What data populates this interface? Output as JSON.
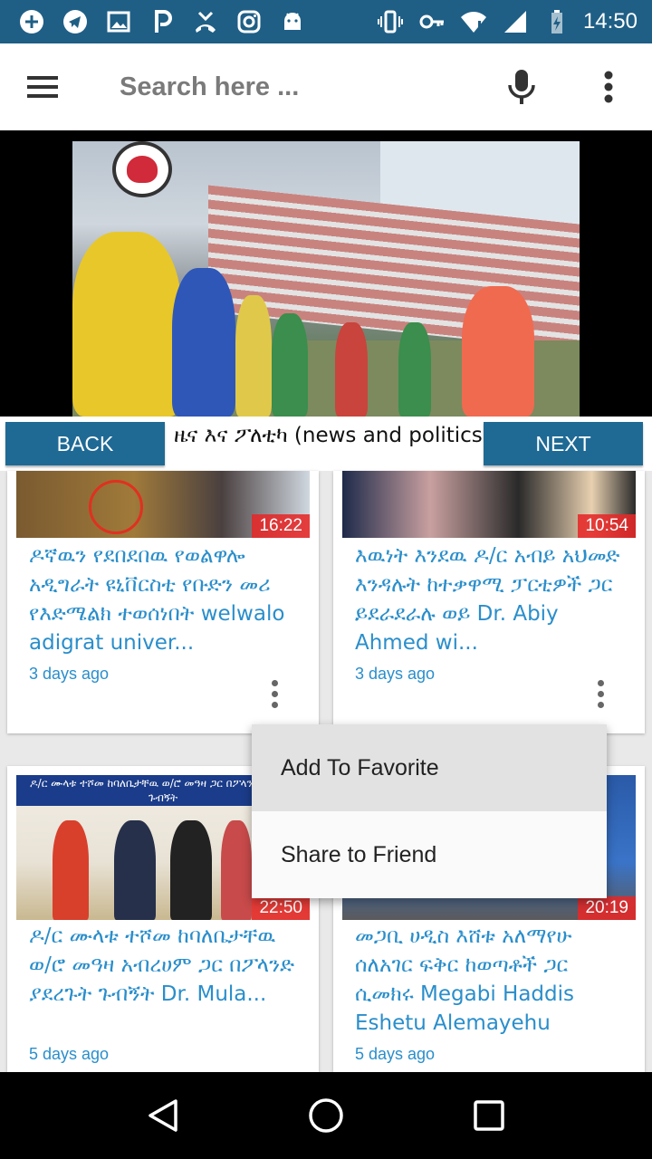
{
  "status_bar": {
    "time": "14:50",
    "left_icons": [
      "add-circle-icon",
      "telegram-icon",
      "image-icon",
      "parking-icon",
      "missed-call-icon",
      "instagram-icon",
      "android-icon"
    ],
    "right_icons": [
      "vibrate-icon",
      "key-icon",
      "wifi-icon",
      "signal-icon",
      "battery-charging-icon"
    ]
  },
  "toolbar": {
    "search_placeholder": "Search here ...",
    "menu_icon": "hamburger-menu-icon",
    "mic_icon": "microphone-icon",
    "overflow_icon": "more-vert-icon"
  },
  "navigation": {
    "back_label": "BACK",
    "next_label": "NEXT",
    "category_title": "ዜና እና ፖለቲካ (news and politics)"
  },
  "videos": [
    {
      "duration": "16:22",
      "title": "ዶኛዉን የደበደበዉ  የወልዋሎ አዲግራት ዩኒቨርስቲ የቡድን መሪ የእድሜልክ ተወሰነበት welwalo adigrat univer...",
      "date": "3 days ago"
    },
    {
      "duration": "10:54",
      "title": "እዉነት እንደዉ  ዶ/ር አብይ አህመድ እንዳሉት  ከተቃዋሚ ፓርቲዎች ጋር ይደራደራሉ ወይ Dr. Abiy Ahmed wi...",
      "date": "3 days ago"
    },
    {
      "duration": "22:50",
      "thumb_caption": "ዶ/ር ሙላቱ ተሾመ ከባለቤታቸዉ ወ/ሮ መዓዛ ጋር በፖላንድ ያደረጉት ጉብኝት",
      "title": "ዶ/ር ሙላቱ ተሾመ ከባለቤታቸዉ ወ/ሮ መዓዛ አብረሀም ጋር በፖላንድ ያደረጉት ጉብኝት Dr. Mula...",
      "date": "5 days ago"
    },
    {
      "duration": "20:19",
      "title": "መጋቢ ሀዲስ እሸቱ አለማየሁ ሰለአገር ፍቅር ከወጣቶች ጋር ሲመክሩ Megabi Haddis Eshetu Alemayehu",
      "date": "5 days ago"
    }
  ],
  "popup_menu": {
    "items": [
      "Add To Favorite",
      "Share to Friend"
    ]
  },
  "colors": {
    "status_bar": "#1f5f86",
    "button_blue": "#1f6a95",
    "link_blue": "#2a8ecb",
    "duration_badge": "#e62828"
  }
}
